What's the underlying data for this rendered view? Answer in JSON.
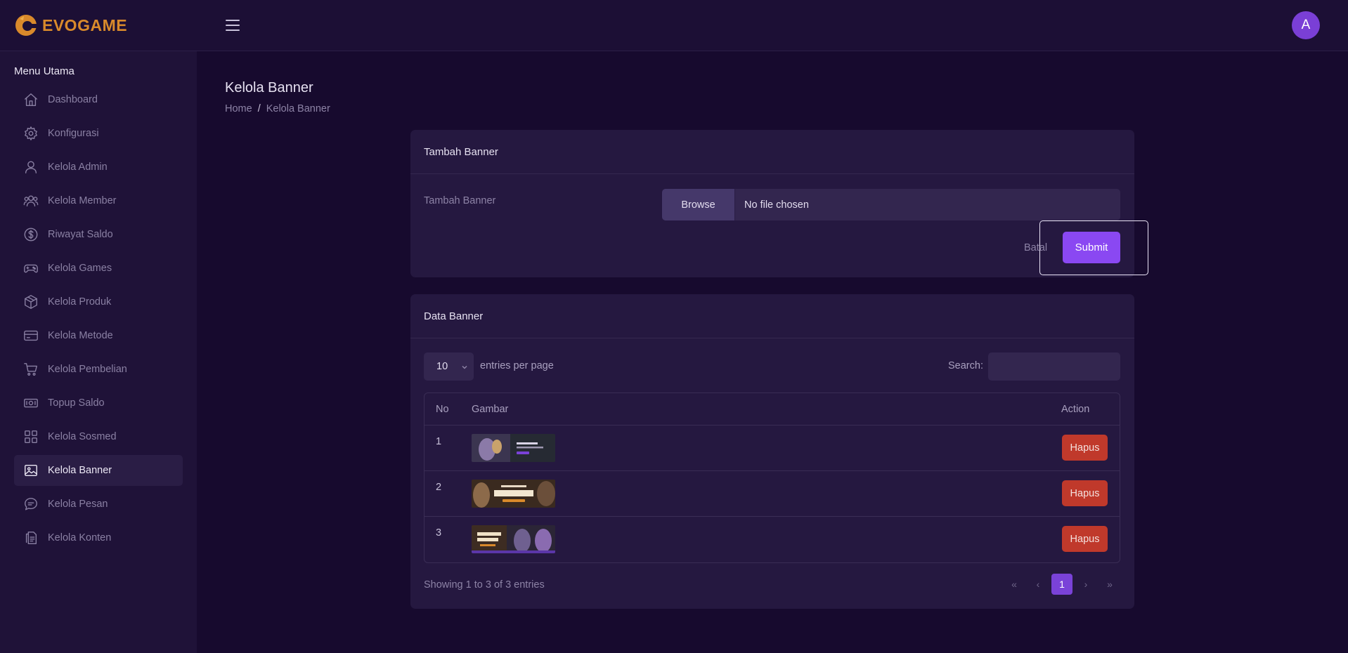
{
  "brand": {
    "name": "EVOGAME",
    "logo_color": "#d98a2b"
  },
  "header": {
    "avatar_initial": "A"
  },
  "sidebar": {
    "section_title": "Menu Utama",
    "items": [
      {
        "label": "Dashboard",
        "icon": "home-icon"
      },
      {
        "label": "Konfigurasi",
        "icon": "gear-icon"
      },
      {
        "label": "Kelola Admin",
        "icon": "user-icon"
      },
      {
        "label": "Kelola Member",
        "icon": "users-icon"
      },
      {
        "label": "Riwayat Saldo",
        "icon": "dollar-icon"
      },
      {
        "label": "Kelola Games",
        "icon": "gamepad-icon"
      },
      {
        "label": "Kelola Produk",
        "icon": "box-icon"
      },
      {
        "label": "Kelola Metode",
        "icon": "card-icon"
      },
      {
        "label": "Kelola Pembelian",
        "icon": "cart-icon"
      },
      {
        "label": "Topup Saldo",
        "icon": "money-icon"
      },
      {
        "label": "Kelola Sosmed",
        "icon": "grid-icon"
      },
      {
        "label": "Kelola Banner",
        "icon": "image-icon",
        "active": true
      },
      {
        "label": "Kelola Pesan",
        "icon": "chat-icon"
      },
      {
        "label": "Kelola Konten",
        "icon": "document-icon"
      }
    ]
  },
  "page": {
    "title": "Kelola Banner",
    "breadcrumb": {
      "home": "Home",
      "separator": "/",
      "current": "Kelola Banner"
    }
  },
  "form_card": {
    "title": "Tambah Banner",
    "field_label": "Tambah Banner",
    "browse_label": "Browse",
    "no_file_label": "No file chosen",
    "cancel_label": "Batal",
    "submit_label": "Submit"
  },
  "data_card": {
    "title": "Data Banner",
    "per_page_value": "10",
    "per_page_label": "entries per page",
    "search_label": "Search:",
    "columns": {
      "no": "No",
      "image": "Gambar",
      "action": "Action"
    },
    "rows": [
      {
        "no": "1",
        "action": "Hapus"
      },
      {
        "no": "2",
        "action": "Hapus"
      },
      {
        "no": "3",
        "action": "Hapus"
      }
    ],
    "showing": "Showing 1 to 3 of 3 entries",
    "pager": {
      "first": "«",
      "prev": "‹",
      "current": "1",
      "next": "›",
      "last": "»"
    }
  },
  "colors": {
    "accent": "#8a48f2",
    "danger": "#c0392b",
    "background": "#170a2e",
    "sidebar": "#1f1238",
    "card": "#251840"
  }
}
